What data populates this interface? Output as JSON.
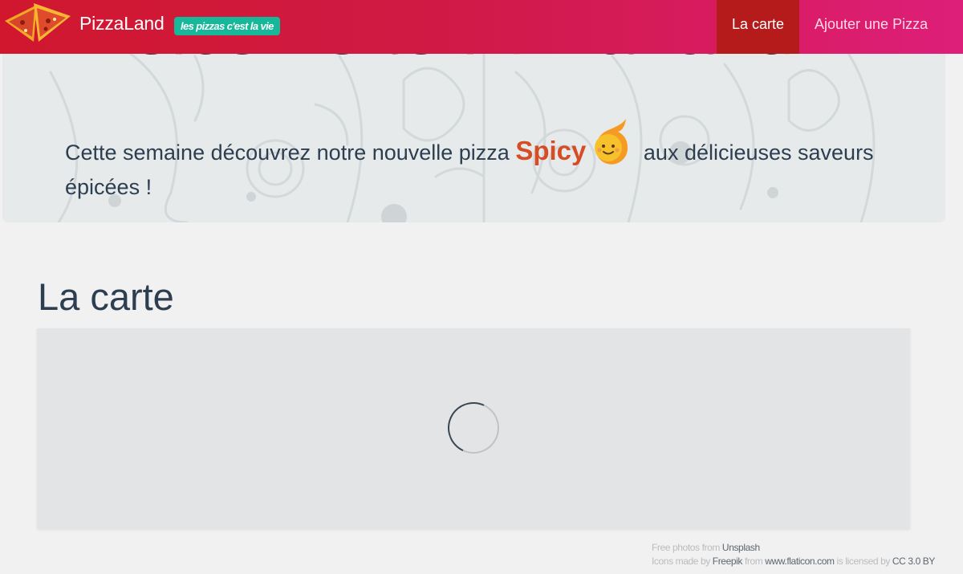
{
  "header": {
    "brand": "PizzaLand",
    "slogan": "les pizzas c'est la vie",
    "nav": [
      {
        "label": "La carte",
        "active": true
      },
      {
        "label": "Ajouter une Pizza",
        "active": false
      }
    ],
    "colors": {
      "gradient_start": "#d0172e",
      "gradient_end": "#de1f7a",
      "active_bg": "#b51b1b",
      "slogan_bg": "#17b899"
    }
  },
  "hero": {
    "title": "Welcome to PizzaLand !",
    "text_before": "Cette semaine découvrez notre nouvelle pizza",
    "highlight": "Spicy",
    "highlight_icon": "fire-icon",
    "text_after": "aux délicieuses saveurs épicées !"
  },
  "main": {
    "section_title": "La carte",
    "list_state": "loading"
  },
  "credits": {
    "photos_prefix": "Free photos from",
    "photos_link": "Unsplash",
    "icons_prefix": "Icons made by",
    "icons_author": "Freepik",
    "from": "from",
    "icons_site": "www.flaticon.com",
    "licensed_by": "is licensed by",
    "license": "CC 3.0 BY"
  }
}
